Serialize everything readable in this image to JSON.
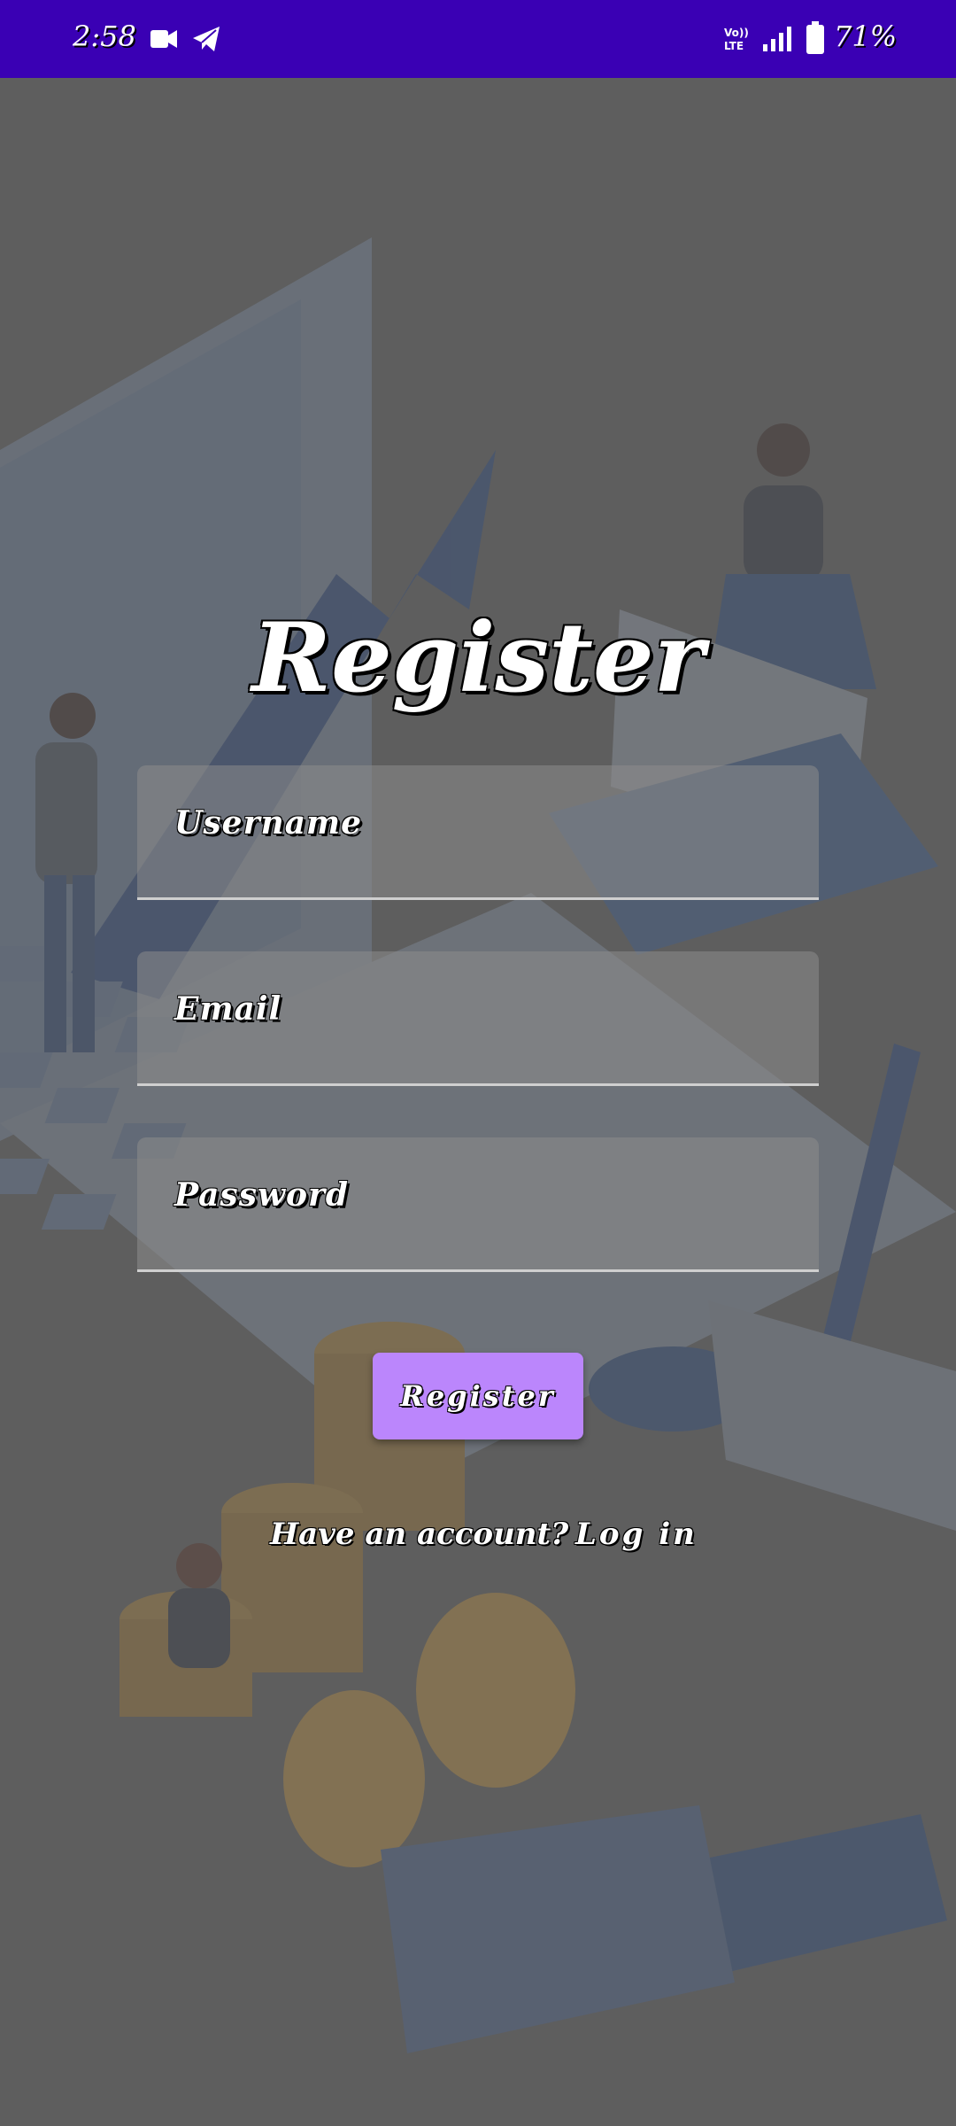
{
  "status_bar": {
    "time": "2:58",
    "network_label": "Vo)) LTE",
    "battery": "71%",
    "icons": [
      "video-camera-icon",
      "telegram-icon",
      "volte-icon",
      "signal-icon",
      "battery-icon"
    ]
  },
  "screen": {
    "title": "Register",
    "fields": {
      "username": "Username",
      "email": "Email",
      "password": "Password"
    },
    "register_button": "Register",
    "have_account": "Have an account?",
    "login_link": "Log in"
  },
  "colors": {
    "status_bar_bg": "#3a00b4",
    "button_bg": "#bb86fc",
    "page_bg": "#5e5e5e"
  }
}
